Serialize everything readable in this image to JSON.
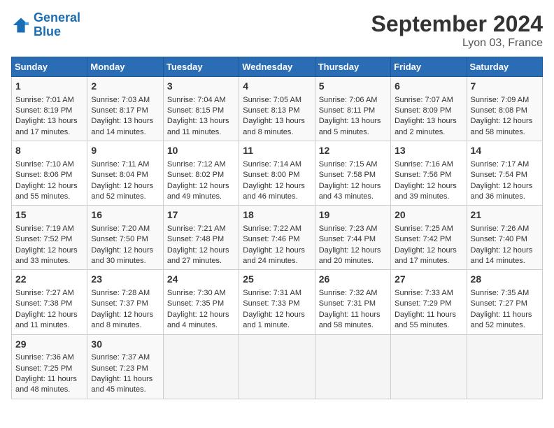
{
  "header": {
    "logo_general": "General",
    "logo_blue": "Blue",
    "month_title": "September 2024",
    "location": "Lyon 03, France"
  },
  "weekdays": [
    "Sunday",
    "Monday",
    "Tuesday",
    "Wednesday",
    "Thursday",
    "Friday",
    "Saturday"
  ],
  "weeks": [
    [
      {
        "day": "1",
        "info": "Sunrise: 7:01 AM\nSunset: 8:19 PM\nDaylight: 13 hours\nand 17 minutes."
      },
      {
        "day": "2",
        "info": "Sunrise: 7:03 AM\nSunset: 8:17 PM\nDaylight: 13 hours\nand 14 minutes."
      },
      {
        "day": "3",
        "info": "Sunrise: 7:04 AM\nSunset: 8:15 PM\nDaylight: 13 hours\nand 11 minutes."
      },
      {
        "day": "4",
        "info": "Sunrise: 7:05 AM\nSunset: 8:13 PM\nDaylight: 13 hours\nand 8 minutes."
      },
      {
        "day": "5",
        "info": "Sunrise: 7:06 AM\nSunset: 8:11 PM\nDaylight: 13 hours\nand 5 minutes."
      },
      {
        "day": "6",
        "info": "Sunrise: 7:07 AM\nSunset: 8:09 PM\nDaylight: 13 hours\nand 2 minutes."
      },
      {
        "day": "7",
        "info": "Sunrise: 7:09 AM\nSunset: 8:08 PM\nDaylight: 12 hours\nand 58 minutes."
      }
    ],
    [
      {
        "day": "8",
        "info": "Sunrise: 7:10 AM\nSunset: 8:06 PM\nDaylight: 12 hours\nand 55 minutes."
      },
      {
        "day": "9",
        "info": "Sunrise: 7:11 AM\nSunset: 8:04 PM\nDaylight: 12 hours\nand 52 minutes."
      },
      {
        "day": "10",
        "info": "Sunrise: 7:12 AM\nSunset: 8:02 PM\nDaylight: 12 hours\nand 49 minutes."
      },
      {
        "day": "11",
        "info": "Sunrise: 7:14 AM\nSunset: 8:00 PM\nDaylight: 12 hours\nand 46 minutes."
      },
      {
        "day": "12",
        "info": "Sunrise: 7:15 AM\nSunset: 7:58 PM\nDaylight: 12 hours\nand 43 minutes."
      },
      {
        "day": "13",
        "info": "Sunrise: 7:16 AM\nSunset: 7:56 PM\nDaylight: 12 hours\nand 39 minutes."
      },
      {
        "day": "14",
        "info": "Sunrise: 7:17 AM\nSunset: 7:54 PM\nDaylight: 12 hours\nand 36 minutes."
      }
    ],
    [
      {
        "day": "15",
        "info": "Sunrise: 7:19 AM\nSunset: 7:52 PM\nDaylight: 12 hours\nand 33 minutes."
      },
      {
        "day": "16",
        "info": "Sunrise: 7:20 AM\nSunset: 7:50 PM\nDaylight: 12 hours\nand 30 minutes."
      },
      {
        "day": "17",
        "info": "Sunrise: 7:21 AM\nSunset: 7:48 PM\nDaylight: 12 hours\nand 27 minutes."
      },
      {
        "day": "18",
        "info": "Sunrise: 7:22 AM\nSunset: 7:46 PM\nDaylight: 12 hours\nand 24 minutes."
      },
      {
        "day": "19",
        "info": "Sunrise: 7:23 AM\nSunset: 7:44 PM\nDaylight: 12 hours\nand 20 minutes."
      },
      {
        "day": "20",
        "info": "Sunrise: 7:25 AM\nSunset: 7:42 PM\nDaylight: 12 hours\nand 17 minutes."
      },
      {
        "day": "21",
        "info": "Sunrise: 7:26 AM\nSunset: 7:40 PM\nDaylight: 12 hours\nand 14 minutes."
      }
    ],
    [
      {
        "day": "22",
        "info": "Sunrise: 7:27 AM\nSunset: 7:38 PM\nDaylight: 12 hours\nand 11 minutes."
      },
      {
        "day": "23",
        "info": "Sunrise: 7:28 AM\nSunset: 7:37 PM\nDaylight: 12 hours\nand 8 minutes."
      },
      {
        "day": "24",
        "info": "Sunrise: 7:30 AM\nSunset: 7:35 PM\nDaylight: 12 hours\nand 4 minutes."
      },
      {
        "day": "25",
        "info": "Sunrise: 7:31 AM\nSunset: 7:33 PM\nDaylight: 12 hours\nand 1 minute."
      },
      {
        "day": "26",
        "info": "Sunrise: 7:32 AM\nSunset: 7:31 PM\nDaylight: 11 hours\nand 58 minutes."
      },
      {
        "day": "27",
        "info": "Sunrise: 7:33 AM\nSunset: 7:29 PM\nDaylight: 11 hours\nand 55 minutes."
      },
      {
        "day": "28",
        "info": "Sunrise: 7:35 AM\nSunset: 7:27 PM\nDaylight: 11 hours\nand 52 minutes."
      }
    ],
    [
      {
        "day": "29",
        "info": "Sunrise: 7:36 AM\nSunset: 7:25 PM\nDaylight: 11 hours\nand 48 minutes."
      },
      {
        "day": "30",
        "info": "Sunrise: 7:37 AM\nSunset: 7:23 PM\nDaylight: 11 hours\nand 45 minutes."
      },
      {
        "day": "",
        "info": ""
      },
      {
        "day": "",
        "info": ""
      },
      {
        "day": "",
        "info": ""
      },
      {
        "day": "",
        "info": ""
      },
      {
        "day": "",
        "info": ""
      }
    ]
  ]
}
